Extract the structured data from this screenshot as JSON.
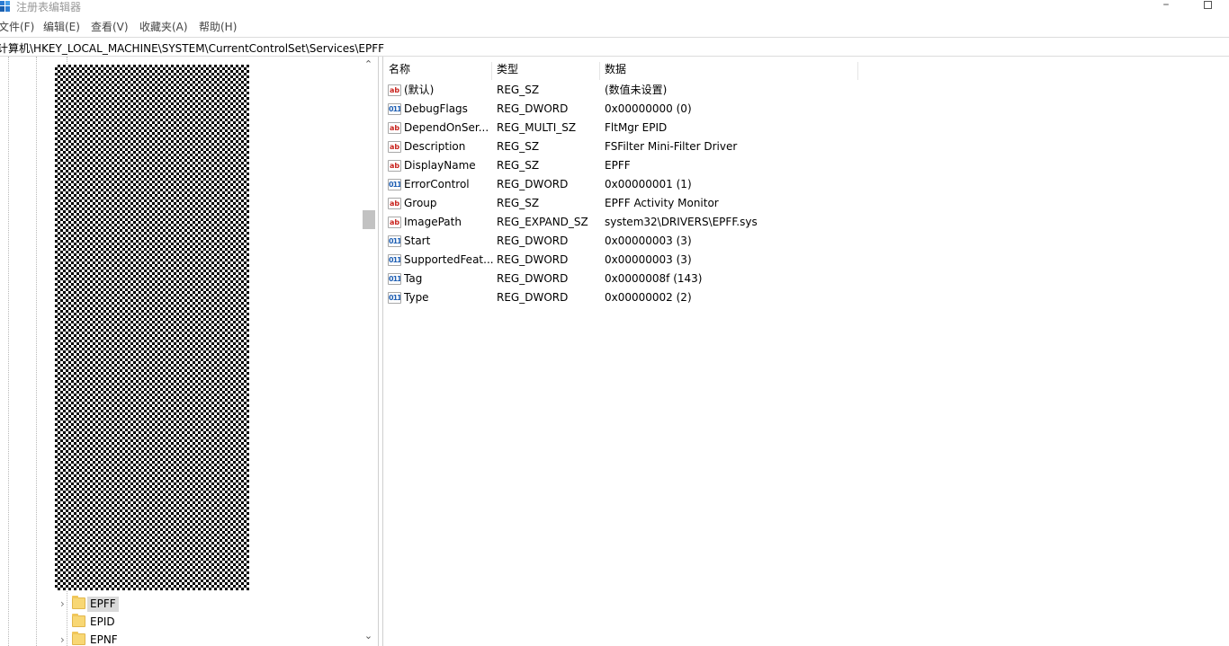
{
  "window": {
    "title": "注册表编辑器"
  },
  "menu": [
    "文件(F)",
    "编辑(E)",
    "查看(V)",
    "收藏夹(A)",
    "帮助(H)"
  ],
  "address": {
    "path": "计算机\\HKEY_LOCAL_MACHINE\\SYSTEM\\CurrentControlSet\\Services\\EPFF"
  },
  "tree": {
    "nodes": [
      {
        "label": "EPFF",
        "expander": "›",
        "selected": true
      },
      {
        "label": "EPID",
        "expander": "",
        "selected": false
      },
      {
        "label": "EPNF",
        "expander": "›",
        "selected": false
      }
    ]
  },
  "list": {
    "columns": {
      "name": "名称",
      "type": "类型",
      "data": "数据"
    },
    "rows": [
      {
        "icon": "string-value-icon",
        "glyph": "ab",
        "name": "(默认)",
        "type": "REG_SZ",
        "data": "(数值未设置)"
      },
      {
        "icon": "binary-value-icon",
        "glyph": "011",
        "name": "DebugFlags",
        "type": "REG_DWORD",
        "data": "0x00000000 (0)"
      },
      {
        "icon": "string-value-icon",
        "glyph": "ab",
        "name": "DependOnSer...",
        "type": "REG_MULTI_SZ",
        "data": "FltMgr EPID"
      },
      {
        "icon": "string-value-icon",
        "glyph": "ab",
        "name": "Description",
        "type": "REG_SZ",
        "data": "FSFilter Mini-Filter Driver"
      },
      {
        "icon": "string-value-icon",
        "glyph": "ab",
        "name": "DisplayName",
        "type": "REG_SZ",
        "data": "EPFF"
      },
      {
        "icon": "binary-value-icon",
        "glyph": "011",
        "name": "ErrorControl",
        "type": "REG_DWORD",
        "data": "0x00000001 (1)"
      },
      {
        "icon": "string-value-icon",
        "glyph": "ab",
        "name": "Group",
        "type": "REG_SZ",
        "data": "EPFF Activity Monitor"
      },
      {
        "icon": "string-value-icon",
        "glyph": "ab",
        "name": "ImagePath",
        "type": "REG_EXPAND_SZ",
        "data": "system32\\DRIVERS\\EPFF.sys"
      },
      {
        "icon": "binary-value-icon",
        "glyph": "011",
        "name": "Start",
        "type": "REG_DWORD",
        "data": "0x00000003 (3)"
      },
      {
        "icon": "binary-value-icon",
        "glyph": "011",
        "name": "SupportedFeat...",
        "type": "REG_DWORD",
        "data": "0x00000003 (3)"
      },
      {
        "icon": "binary-value-icon",
        "glyph": "011",
        "name": "Tag",
        "type": "REG_DWORD",
        "data": "0x0000008f (143)"
      },
      {
        "icon": "binary-value-icon",
        "glyph": "011",
        "name": "Type",
        "type": "REG_DWORD",
        "data": "0x00000002 (2)"
      }
    ]
  },
  "colors": {
    "selection": "#d9d9d9",
    "string_icon": "#c8231d",
    "binary_icon": "#1f5fb3",
    "folder": "#f8d774"
  }
}
